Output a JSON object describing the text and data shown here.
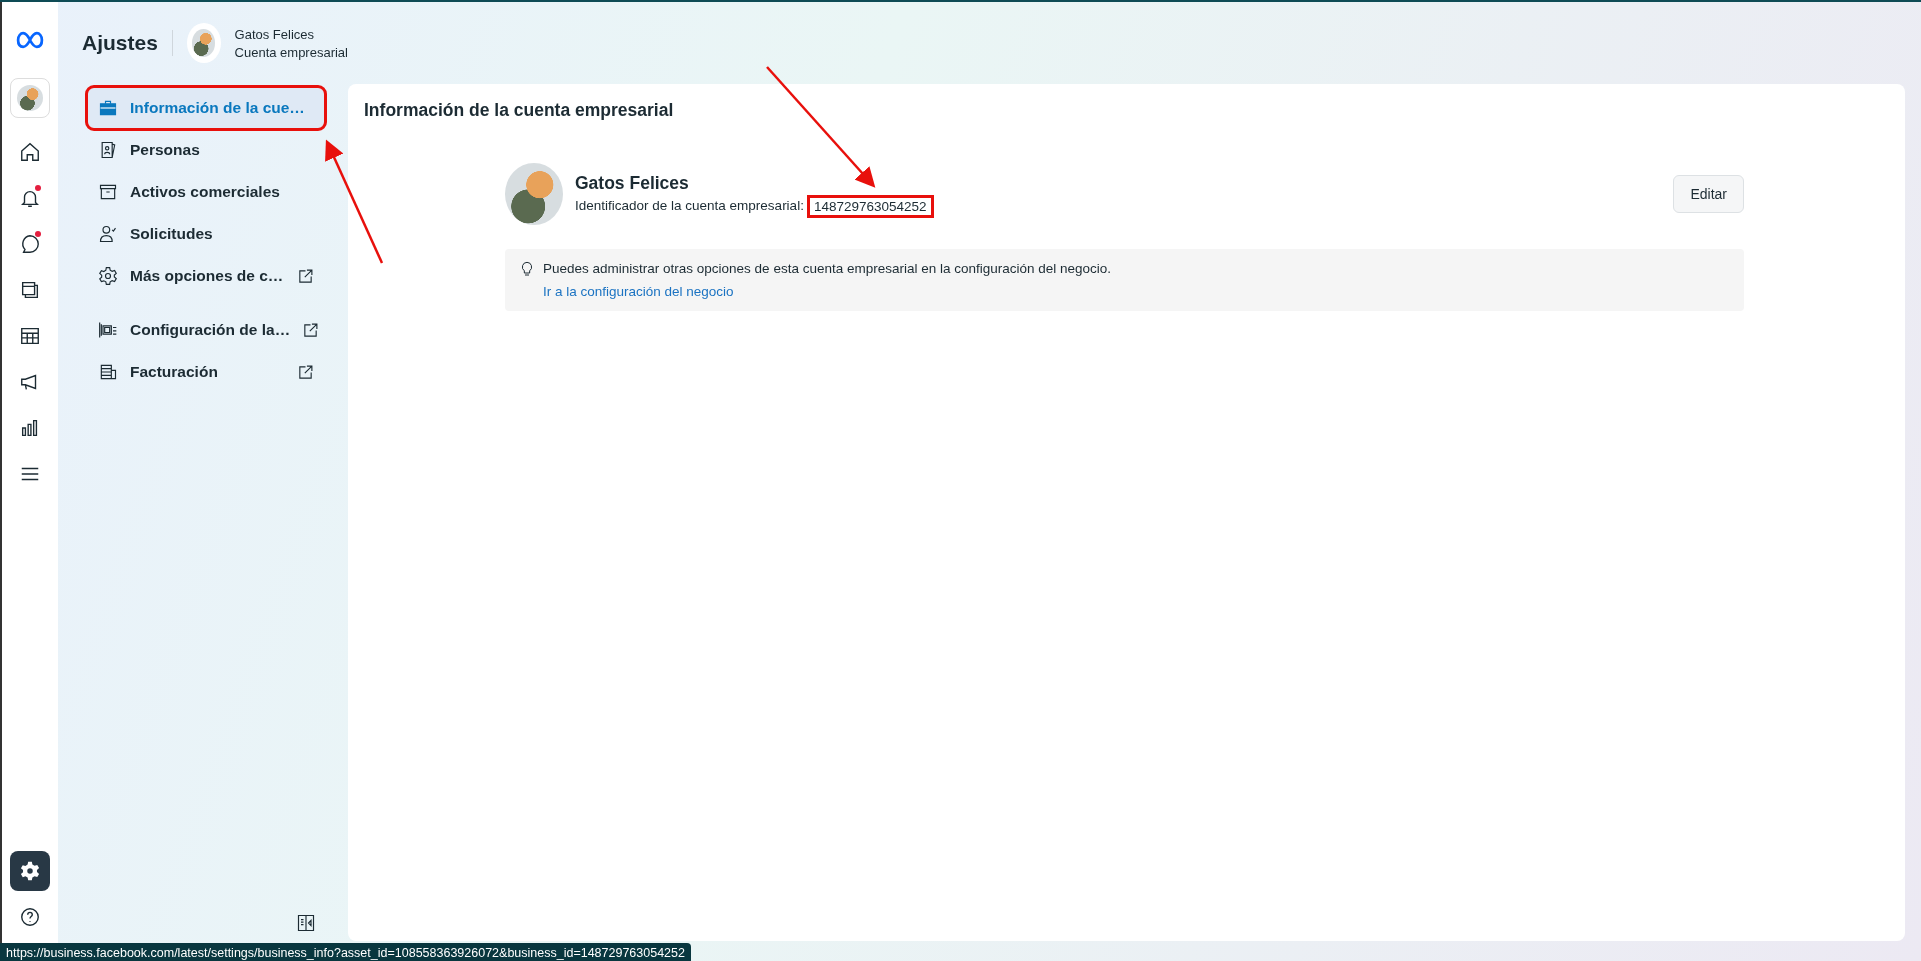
{
  "header": {
    "title": "Ajustes",
    "account_name": "Gatos Felices",
    "account_type": "Cuenta empresarial"
  },
  "rail": [
    {
      "kind": "home",
      "badge": false,
      "selected": false
    },
    {
      "kind": "bell",
      "badge": true,
      "selected": false
    },
    {
      "kind": "chat",
      "badge": true,
      "selected": false
    },
    {
      "kind": "pages",
      "badge": false,
      "selected": false
    },
    {
      "kind": "table",
      "badge": false,
      "selected": false
    },
    {
      "kind": "megaphone",
      "badge": false,
      "selected": false
    },
    {
      "kind": "chart",
      "badge": false,
      "selected": false
    },
    {
      "kind": "menu",
      "badge": false,
      "selected": false
    }
  ],
  "rail_bottom": [
    {
      "kind": "gear",
      "selected": true
    },
    {
      "kind": "help",
      "selected": false
    }
  ],
  "nav": [
    {
      "kind": "briefcase",
      "label": "Información de la cue…",
      "selected": true,
      "external": false,
      "highlighted": true
    },
    {
      "kind": "badge",
      "label": "Personas",
      "selected": false,
      "external": false,
      "highlighted": false
    },
    {
      "kind": "archive",
      "label": "Activos comerciales",
      "selected": false,
      "external": false,
      "highlighted": false
    },
    {
      "kind": "person",
      "label": "Solicitudes",
      "selected": false,
      "external": false,
      "highlighted": false
    },
    {
      "kind": "gear",
      "label": "Más opciones de c…",
      "selected": false,
      "external": true,
      "highlighted": false
    },
    {
      "kind": "stack",
      "label": "Configuración de la…",
      "selected": false,
      "external": true,
      "highlighted": false
    },
    {
      "kind": "coins",
      "label": "Facturación",
      "selected": false,
      "external": true,
      "highlighted": false
    }
  ],
  "main": {
    "title": "Información de la cuenta empresarial",
    "name": "Gatos Felices",
    "id_label": "Identificador de la cuenta empresarial:",
    "id_value": "148729763054252",
    "id_highlighted": true,
    "edit_button": "Editar",
    "notice": "Puedes administrar otras opciones de esta cuenta empresarial en la configuración del negocio.",
    "notice_link": "Ir a la configuración del negocio"
  },
  "status_bar": {
    "url": "https://business.facebook.com/latest/settings/business_info?asset_id=108558363926072&business_id=148729763054252"
  }
}
